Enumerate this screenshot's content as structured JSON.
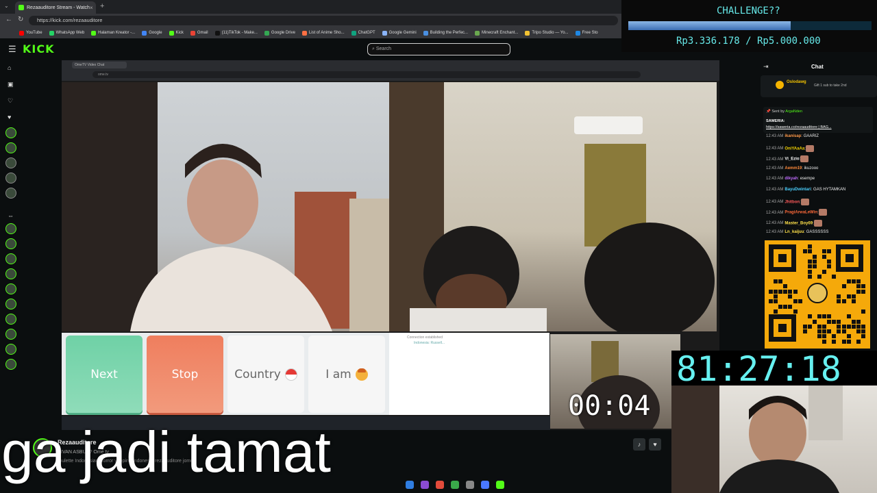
{
  "browser": {
    "tab_title": "Rezaauditore Stream - Watch",
    "new_tab": "+",
    "url": "https://kick.com/rezaauditore",
    "bookmarks": [
      "YouTube",
      "WhatsApp Web",
      "Halaman Kreator -...",
      "Google",
      "Kick",
      "Gmail",
      "(11)TikTok - Make...",
      "Google Drive",
      "List of Anime Sho...",
      "ChatGPT",
      "Google Gemini",
      "Building the Perfec...",
      "Minecraft Enchant...",
      "Tripo Studio — Yo...",
      "Free Sto"
    ]
  },
  "kick": {
    "logo": "KICK",
    "search_placeholder": "Search"
  },
  "challenge": {
    "title": "CHALLENGE??",
    "amount": "Rp3.336.178 / Rp5.000.000",
    "progress_fraction": 0.667
  },
  "omegle": {
    "next": "Next",
    "stop": "Stop",
    "country": "Country",
    "iam": "I am",
    "connection": "Connection established",
    "country_info": "Indonesia: Russell..."
  },
  "timers": {
    "call": "00:04",
    "subathon": "81:27:18"
  },
  "chat": {
    "title": "Chat",
    "pinned_user": "Oslodawg",
    "pinned_text": "Gift 1 sub to take 2nd",
    "saweria_sent_by": "Sent by",
    "saweria_user": "ArgaNden",
    "saweria_label": "SAWERIA:",
    "saweria_link": "https://saweria.co/rezaauditore | BAG...",
    "messages": [
      {
        "time": "12:43 AM",
        "user": "ikanisap",
        "text": ": GAARIZ",
        "color": "#ff9a4a"
      },
      {
        "time": "12:43 AM",
        "user": "OniYAaAa",
        "text": ":",
        "color": "#f5d400"
      },
      {
        "time": "12:43 AM",
        "user": "Vi_Ezio",
        "text": ":",
        "color": "#ffffff"
      },
      {
        "time": "12:43 AM",
        "user": "Aemm19",
        "text": ": ikuzooo",
        "color": "#ff8a3a"
      },
      {
        "time": "12:43 AM",
        "user": "dikyah",
        "text": ": esempe",
        "color": "#c06cff"
      },
      {
        "time": "12:43 AM",
        "user": "BayuDwintari",
        "text": ": GAS HYTAMKAN",
        "color": "#4ad0ff"
      },
      {
        "time": "12:43 AM",
        "user": "Jhitbon",
        "text": ":",
        "color": "#ff5a5a"
      },
      {
        "time": "12:43 AM",
        "user": "PragiArwaLeWin",
        "text": ":",
        "color": "#ff6a3a"
      },
      {
        "time": "12:43 AM",
        "user": "Master_Boy69",
        "text": ":",
        "color": "#ffe14a"
      },
      {
        "time": "12:43 AM",
        "user": "Ln_kaijuu",
        "text": ": GASSSSSS",
        "color": "#ffe14a"
      }
    ]
  },
  "caption": "ga jadi tamat",
  "streamer": {
    "name": "Rezaauditore",
    "title": "DIVAN ASBUN? Ome tv ...",
    "tags": "roulette   Indonesian   Horror   yapping   Indonesia   rezaauditore   jomok"
  }
}
